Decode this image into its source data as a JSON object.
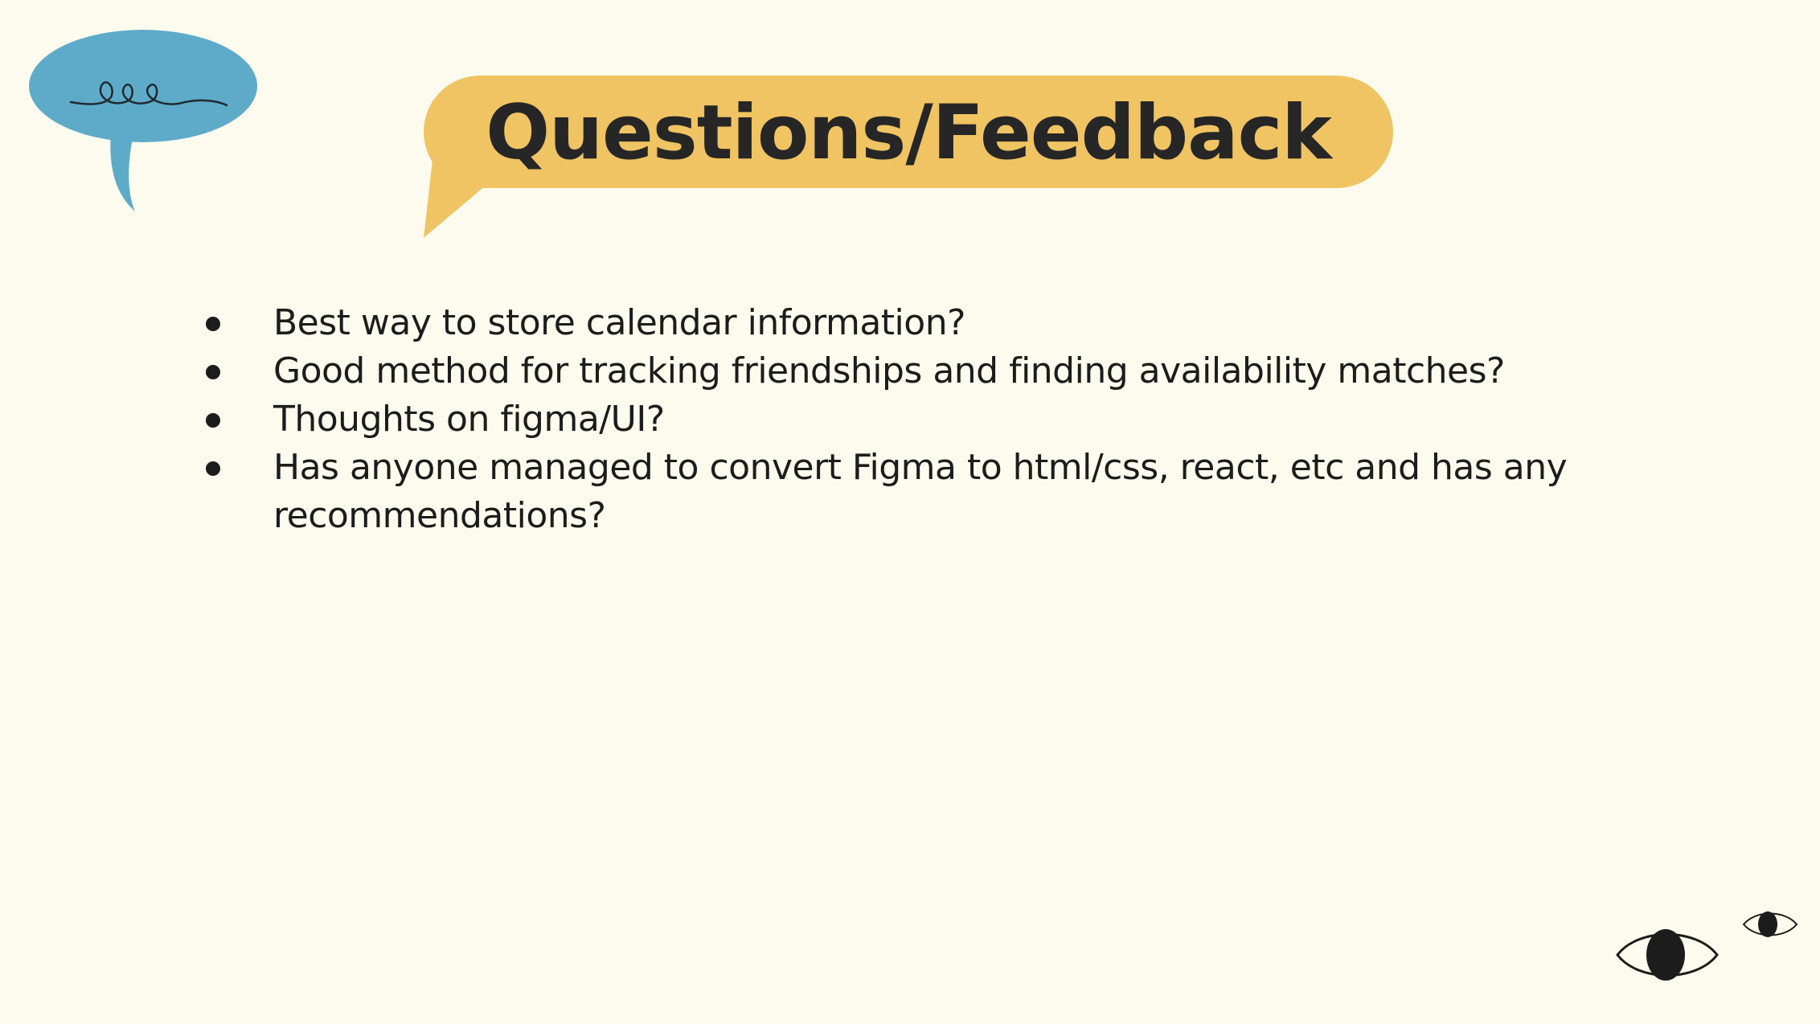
{
  "slide": {
    "title": "Questions/Feedback",
    "bullets": [
      "Best way to store calendar information?",
      "Good method for tracking friendships and finding availability matches?",
      "Thoughts on figma/UI?",
      "Has anyone managed to convert Figma to html/css, react, etc and has any recommendations?"
    ]
  },
  "colors": {
    "background": "#fdfbee",
    "title_bubble": "#f0c462",
    "blue_bubble": "#5eabc9",
    "text": "#1c1c1c"
  },
  "decorations": {
    "blue_bubble_icon": "speech-bubble-squiggle-icon",
    "title_bubble_icon": "speech-bubble-icon",
    "eyes_icon": "eye-icon"
  }
}
